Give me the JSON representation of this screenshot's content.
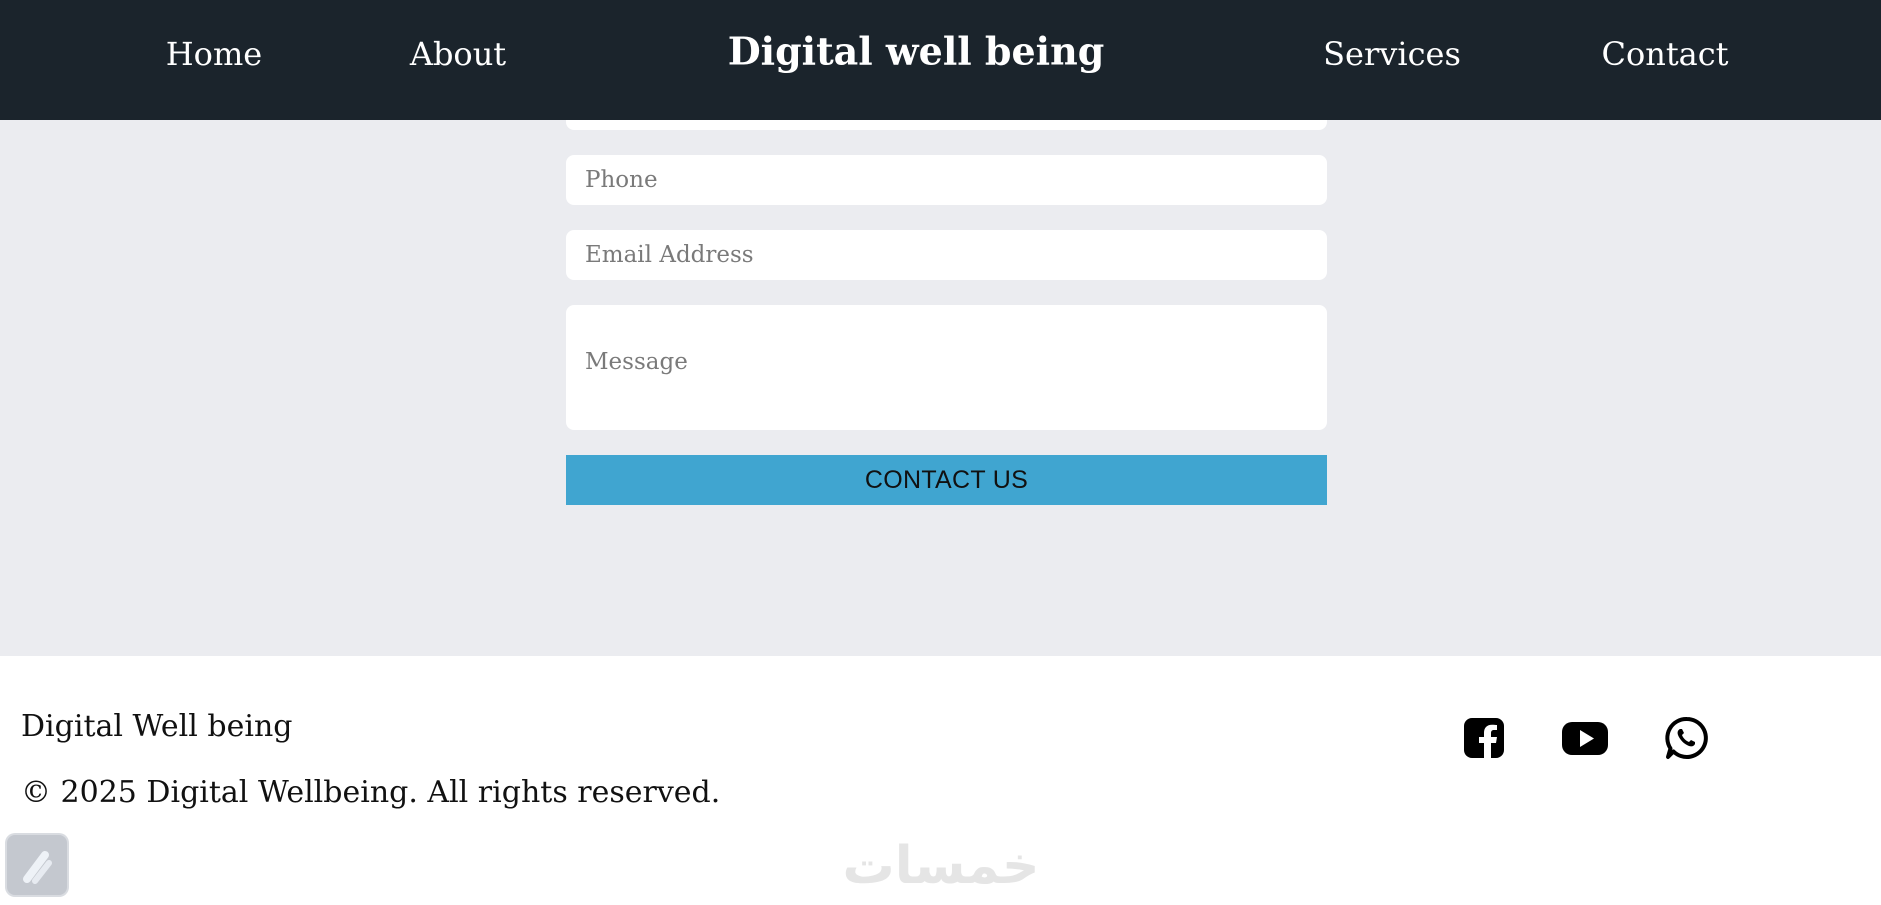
{
  "nav": {
    "links": [
      {
        "label": "Home"
      },
      {
        "label": "About"
      },
      {
        "label": "Services"
      },
      {
        "label": "Contact"
      }
    ],
    "brand": "Digital well being"
  },
  "form": {
    "phone_placeholder": "Phone",
    "email_placeholder": "Email Address",
    "message_placeholder": "Message",
    "submit_label": "CONTACT US"
  },
  "footer": {
    "title": "Digital Well being",
    "copyright": "© 2025 Digital Wellbeing. All rights reserved.",
    "social_icons": [
      "facebook-icon",
      "youtube-icon",
      "whatsapp-icon"
    ]
  },
  "watermark_text": "خمسات",
  "colors": {
    "navbar_bg": "#1b242c",
    "page_bg": "#ebecf0",
    "button_bg": "#40a5d0",
    "footer_bg": "#ffffff"
  }
}
